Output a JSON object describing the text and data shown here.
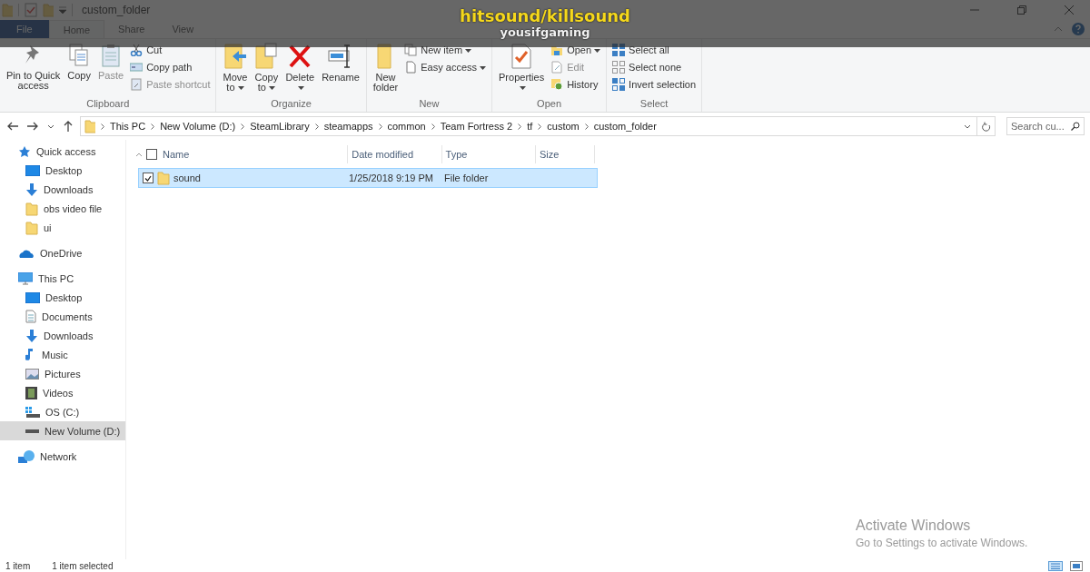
{
  "window": {
    "title": "custom_folder"
  },
  "overlay": {
    "title": "hitsound/killsound",
    "channel": "yousifgaming"
  },
  "tabs": [
    {
      "label": "File",
      "kind": "file",
      "selected": false
    },
    {
      "label": "Home",
      "kind": "tab",
      "selected": true
    },
    {
      "label": "Share",
      "kind": "tab",
      "selected": false
    },
    {
      "label": "View",
      "kind": "tab",
      "selected": false
    }
  ],
  "ribbon": {
    "groups": [
      {
        "label": "Clipboard",
        "items": [
          {
            "kind": "large",
            "lines": [
              "Pin to Quick",
              "access"
            ],
            "dropdown": false,
            "disabled": false
          },
          {
            "kind": "large",
            "lines": [
              "Copy"
            ],
            "dropdown": false,
            "disabled": false
          },
          {
            "kind": "large",
            "lines": [
              "Paste"
            ],
            "dropdown": false,
            "disabled": true
          },
          {
            "kind": "small",
            "label": "Cut",
            "dropdown": false,
            "disabled": false
          },
          {
            "kind": "small",
            "label": "Copy path",
            "dropdown": false,
            "disabled": false
          },
          {
            "kind": "small",
            "label": "Paste shortcut",
            "dropdown": false,
            "disabled": true
          }
        ]
      },
      {
        "label": "Organize",
        "items": [
          {
            "kind": "large",
            "lines": [
              "Move",
              "to"
            ],
            "dropdown": true,
            "disabled": false
          },
          {
            "kind": "large",
            "lines": [
              "Copy",
              "to"
            ],
            "dropdown": true,
            "disabled": false
          },
          {
            "kind": "large",
            "lines": [
              "Delete"
            ],
            "dropdown": true,
            "disabled": false
          },
          {
            "kind": "large",
            "lines": [
              "Rename"
            ],
            "dropdown": false,
            "disabled": false
          }
        ]
      },
      {
        "label": "New",
        "items": [
          {
            "kind": "large",
            "lines": [
              "New",
              "folder"
            ],
            "dropdown": false,
            "disabled": false
          },
          {
            "kind": "small",
            "label": "New item",
            "dropdown": true,
            "disabled": false
          },
          {
            "kind": "small",
            "label": "Easy access",
            "dropdown": true,
            "disabled": false
          }
        ]
      },
      {
        "label": "Open",
        "items": [
          {
            "kind": "large",
            "lines": [
              "Properties"
            ],
            "dropdown": true,
            "disabled": false
          },
          {
            "kind": "small",
            "label": "Open",
            "dropdown": true,
            "disabled": false
          },
          {
            "kind": "small",
            "label": "Edit",
            "dropdown": false,
            "disabled": true
          },
          {
            "kind": "small",
            "label": "History",
            "dropdown": false,
            "disabled": false
          }
        ]
      },
      {
        "label": "Select",
        "items": [
          {
            "kind": "small",
            "label": "Select all",
            "dropdown": false,
            "disabled": false
          },
          {
            "kind": "small",
            "label": "Select none",
            "dropdown": false,
            "disabled": false
          },
          {
            "kind": "small",
            "label": "Invert selection",
            "dropdown": false,
            "disabled": false
          }
        ]
      }
    ]
  },
  "address": {
    "path": [
      "This PC",
      "New Volume (D:)",
      "SteamLibrary",
      "steamapps",
      "common",
      "Team Fortress 2",
      "tf",
      "custom",
      "custom_folder"
    ]
  },
  "search": {
    "placeholder": "Search cu..."
  },
  "navigation": [
    {
      "label": "Quick access",
      "kind": "star",
      "selected": false,
      "children": [
        {
          "label": "Desktop",
          "kind": "desktop",
          "selected": false
        },
        {
          "label": "Downloads",
          "kind": "download",
          "selected": false
        },
        {
          "label": "obs video file",
          "kind": "folder",
          "selected": false
        },
        {
          "label": "ui",
          "kind": "folder",
          "selected": false
        }
      ]
    },
    {
      "label": "OneDrive",
      "kind": "cloud",
      "selected": false
    },
    {
      "label": "This PC",
      "kind": "pc",
      "selected": false,
      "children": [
        {
          "label": "Desktop",
          "kind": "desktop",
          "selected": false
        },
        {
          "label": "Documents",
          "kind": "document",
          "selected": false
        },
        {
          "label": "Downloads",
          "kind": "download",
          "selected": false
        },
        {
          "label": "Music",
          "kind": "music",
          "selected": false
        },
        {
          "label": "Pictures",
          "kind": "image",
          "selected": false
        },
        {
          "label": "Videos",
          "kind": "film",
          "selected": false
        },
        {
          "label": "OS (C:)",
          "kind": "osdrive",
          "selected": false
        },
        {
          "label": "New Volume (D:)",
          "kind": "drive",
          "selected": true
        }
      ]
    },
    {
      "label": "Network",
      "kind": "network",
      "selected": false
    }
  ],
  "table": {
    "columns": [
      "Name",
      "Date modified",
      "Type",
      "Size"
    ],
    "header_checked": false,
    "rows": [
      {
        "name": "sound",
        "date": "1/25/2018 9:19 PM",
        "type": "File folder",
        "checked": true,
        "selected": true
      }
    ]
  },
  "activation": {
    "title": "Activate Windows",
    "text": "Go to Settings to activate Windows."
  },
  "status_bar": [
    "1 item",
    "1 item selected"
  ]
}
